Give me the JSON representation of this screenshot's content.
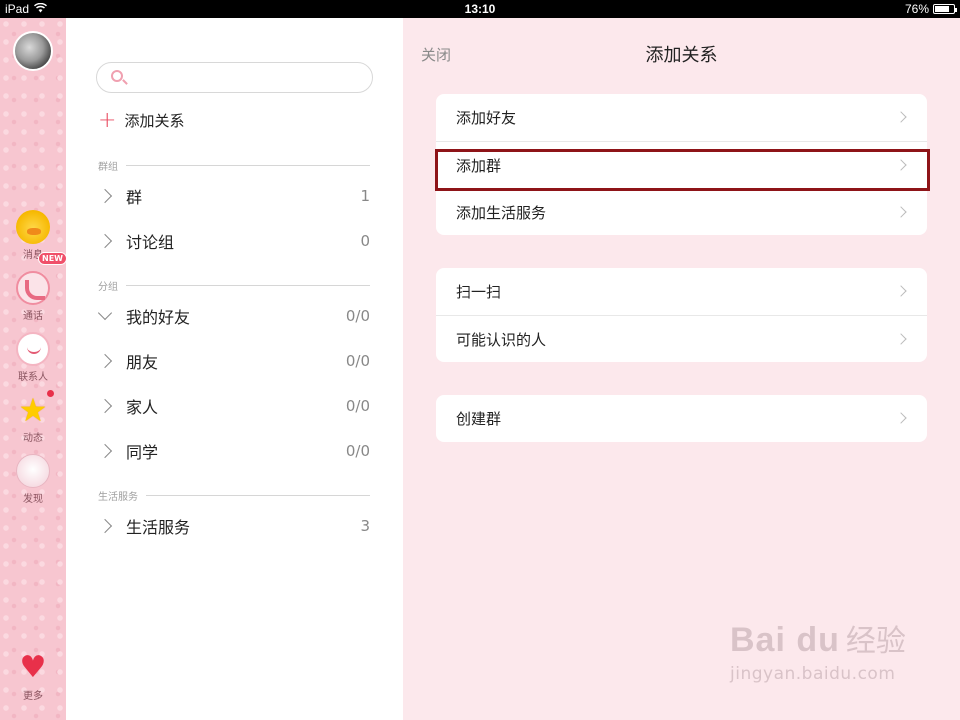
{
  "status_bar": {
    "device": "iPad",
    "time": "13:10",
    "battery": "76%",
    "battery_level": 0.76
  },
  "rail": {
    "items": [
      {
        "label": "消息",
        "icon": "duck-icon"
      },
      {
        "label": "通话",
        "icon": "phone-icon",
        "badge": "NEW"
      },
      {
        "label": "联系人",
        "icon": "contacts-icon"
      },
      {
        "label": "动态",
        "icon": "star-icon",
        "dot": true
      },
      {
        "label": "发现",
        "icon": "discover-icon"
      }
    ],
    "more": {
      "label": "更多",
      "icon": "heart-icon"
    }
  },
  "contacts": {
    "search_placeholder": "",
    "add_relation": "添加关系",
    "sections": [
      {
        "header": "群组",
        "rows": [
          {
            "label": "群",
            "count": "1"
          },
          {
            "label": "讨论组",
            "count": "0"
          }
        ]
      },
      {
        "header": "分组",
        "rows": [
          {
            "label": "我的好友",
            "count": "0/0",
            "expanded": true
          },
          {
            "label": "朋友",
            "count": "0/0"
          },
          {
            "label": "家人",
            "count": "0/0"
          },
          {
            "label": "同学",
            "count": "0/0"
          }
        ]
      },
      {
        "header": "生活服务",
        "rows": [
          {
            "label": "生活服务",
            "count": "3"
          }
        ]
      }
    ]
  },
  "panel": {
    "close_label": "关闭",
    "title": "添加关系",
    "groups": [
      [
        "添加好友",
        "添加群",
        "添加生活服务"
      ],
      [
        "扫一扫",
        "可能认识的人"
      ],
      [
        "创建群"
      ]
    ],
    "highlighted_item": "添加群"
  },
  "watermark": {
    "brand": "Bai du",
    "brand_cn": "经验",
    "url": "jingyan.baidu.com"
  },
  "colors": {
    "accent": "#e84a5f",
    "panel_bg": "#fce8ec",
    "highlight": "#8e1418",
    "rail_bg": "#f7c6d0"
  }
}
